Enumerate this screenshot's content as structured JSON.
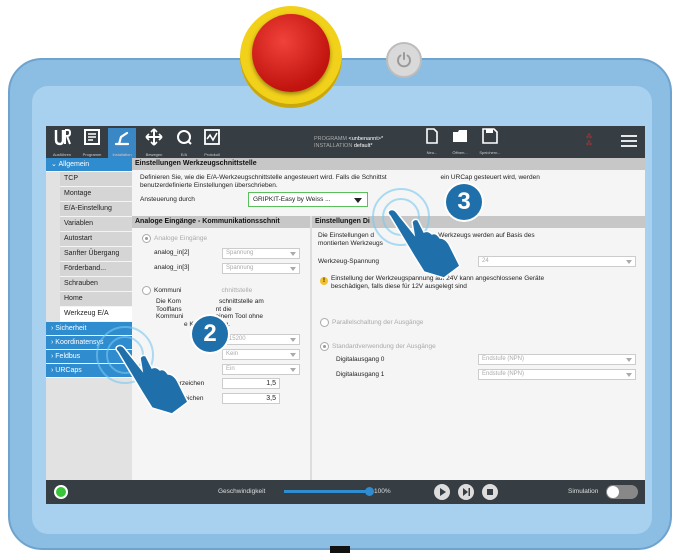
{
  "toolbar": {
    "run": "Ausführen",
    "program": "Programm",
    "installation": "Installation",
    "move": "Bewegen",
    "io": "E/A",
    "log": "Protokoll",
    "program_label": "PROGRAMM",
    "program_name": "<unbenannt>*",
    "installation_label": "INSTALLATION",
    "installation_name": "default*",
    "new": "Neu...",
    "open": "Öffnen...",
    "save": "Speichern..."
  },
  "sidebar": {
    "section_general": "Allgemein",
    "items": [
      "TCP",
      "Montage",
      "E/A-Einstellung",
      "Variablen",
      "Autostart",
      "Sanfter Übergang",
      "Förderband...",
      "Schrauben",
      "Home",
      "Werkzeug E/A"
    ],
    "sections": [
      "Sicherheit",
      "Koordinatensys",
      "Feldbus",
      "URCaps"
    ]
  },
  "content": {
    "title": "Einstellungen Werkzeugschnittstelle",
    "desc1": "Definieren Sie, wie die E/A-Werkzeugschnittstelle angesteuert wird. Falls die Schnittst",
    "desc1b": "ein URCap gesteuert wird, werden",
    "desc2": "benutzerdefinierte Einstellungen überschrieben.",
    "control_label": "Ansteuerung durch",
    "control_value": "GRIPKIT-Easy by Weiss ...",
    "analog_head": "Analoge Eingänge - Kommunikationsschnit",
    "analog_radio": "Analoge Eingänge",
    "analog_in2": "analog_in[2]",
    "analog_in3": "analog_in[3]",
    "voltage": "Spannung",
    "comm_radio": "Kommuni",
    "comm_radio_b": "chnittstelle",
    "comm_text1a": "Die Kom",
    "comm_text1b": "schnittstelle am",
    "comm_text2a": "Toolflans",
    "comm_text2b": "nt die",
    "comm_text3a": "Kommuni",
    "comm_text3b": "einem Tool ohne",
    "comm_text4": "e Kabelführung.",
    "baud_value": "115200",
    "parity_value": "Kein",
    "stop_value": "Ein",
    "rx_label": "RX Leerzeichen",
    "rx_value": "1,5",
    "tx_label": "TX Leerzeichen",
    "tx_value": "3,5",
    "digital_head": "Einstellungen Di",
    "digital_text1a": "Die Einstellungen d",
    "digital_text1b": "des Werkzeugs werden auf Basis des",
    "digital_text2": "montierten Werkzeugs",
    "tool_voltage_label": "Werkzeug-Spannung",
    "tool_voltage_value": "24",
    "warning_text1": "Einstellung der Werkzeugspannung auf 24V kann angeschlossene Geräte",
    "warning_text2": "beschädigen, falls diese für 12V ausgelegt sind",
    "parallel_radio": "Parallelschaltung der Ausgänge",
    "standard_radio": "Standardverwendung der Ausgänge",
    "digital0": "Digitalausgang 0",
    "digital1": "Digitalausgang 1",
    "stage_value": "Endstufe (NPN)"
  },
  "bottom": {
    "speed_label": "Geschwindigkeit",
    "speed_value": "100%",
    "speed_fraction": 1.0,
    "simulation": "Simulation"
  },
  "callouts": {
    "step2": "2",
    "step3": "3"
  },
  "colors": {
    "accent": "#2f8ccf",
    "topbar": "#363e44",
    "pendant": "#8cbde3",
    "estop": "#d01a14",
    "estop_base": "#f2d11b"
  }
}
